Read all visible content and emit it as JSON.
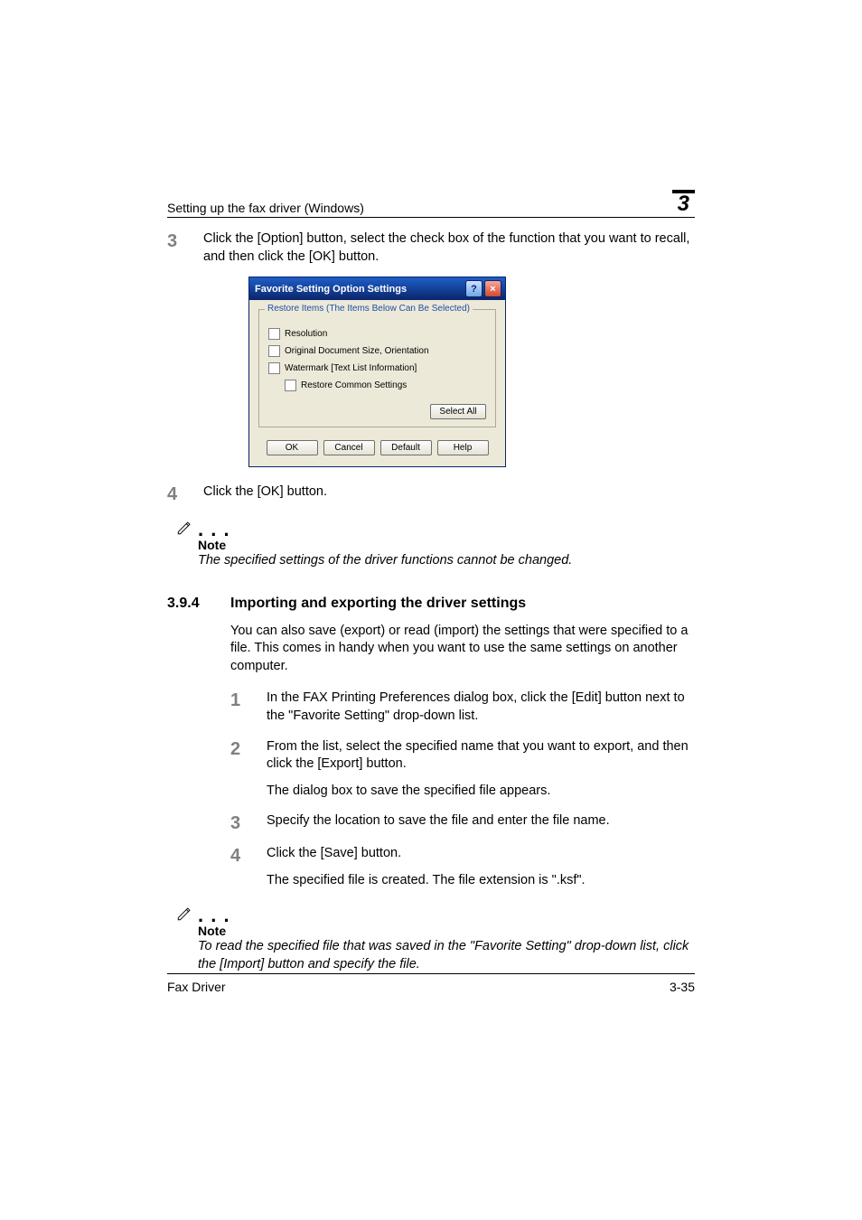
{
  "header": {
    "title": "Setting up the fax driver (Windows)",
    "chapter_number": "3"
  },
  "step3": {
    "num": "3",
    "text": "Click the [Option] button, select the check box of the function that you want to recall, and then click the [OK] button."
  },
  "dialog": {
    "title": "Favorite Setting Option Settings",
    "help_btn": "?",
    "close_btn": "×",
    "legend": "Restore Items (The Items Below Can Be Selected)",
    "opt1": "Resolution",
    "opt2": "Original Document Size, Orientation",
    "opt3": "Watermark [Text List Information]",
    "opt4": "Restore Common Settings",
    "select_all": "Select All",
    "ok": "OK",
    "cancel": "Cancel",
    "default": "Default",
    "help": "Help"
  },
  "step4": {
    "num": "4",
    "text": "Click the [OK] button."
  },
  "note1": {
    "label": "Note",
    "text": "The specified settings of the driver functions cannot be changed."
  },
  "section": {
    "num": "3.9.4",
    "title": "Importing and exporting the driver settings"
  },
  "intro": "You can also save (export) or read (import) the settings that were specified to a file. This comes in handy when you want to use the same settings on another computer.",
  "s1": {
    "num": "1",
    "text": "In the FAX Printing Preferences dialog box, click the [Edit] button next to the \"Favorite Setting\" drop-down list."
  },
  "s2": {
    "num": "2",
    "text": "From the list, select the specified name that you want to export, and then click the [Export] button.",
    "aux": "The dialog box to save the specified file appears."
  },
  "s3": {
    "num": "3",
    "text": "Specify the location to save the file and enter the file name."
  },
  "s4": {
    "num": "4",
    "text": "Click the [Save] button.",
    "aux": "The specified file is created. The file extension is \".ksf\"."
  },
  "note2": {
    "label": "Note",
    "text": "To read the specified file that was saved in the \"Favorite Setting\" drop-down list, click the [Import] button and specify the file."
  },
  "footer": {
    "left": "Fax Driver",
    "right": "3-35"
  }
}
